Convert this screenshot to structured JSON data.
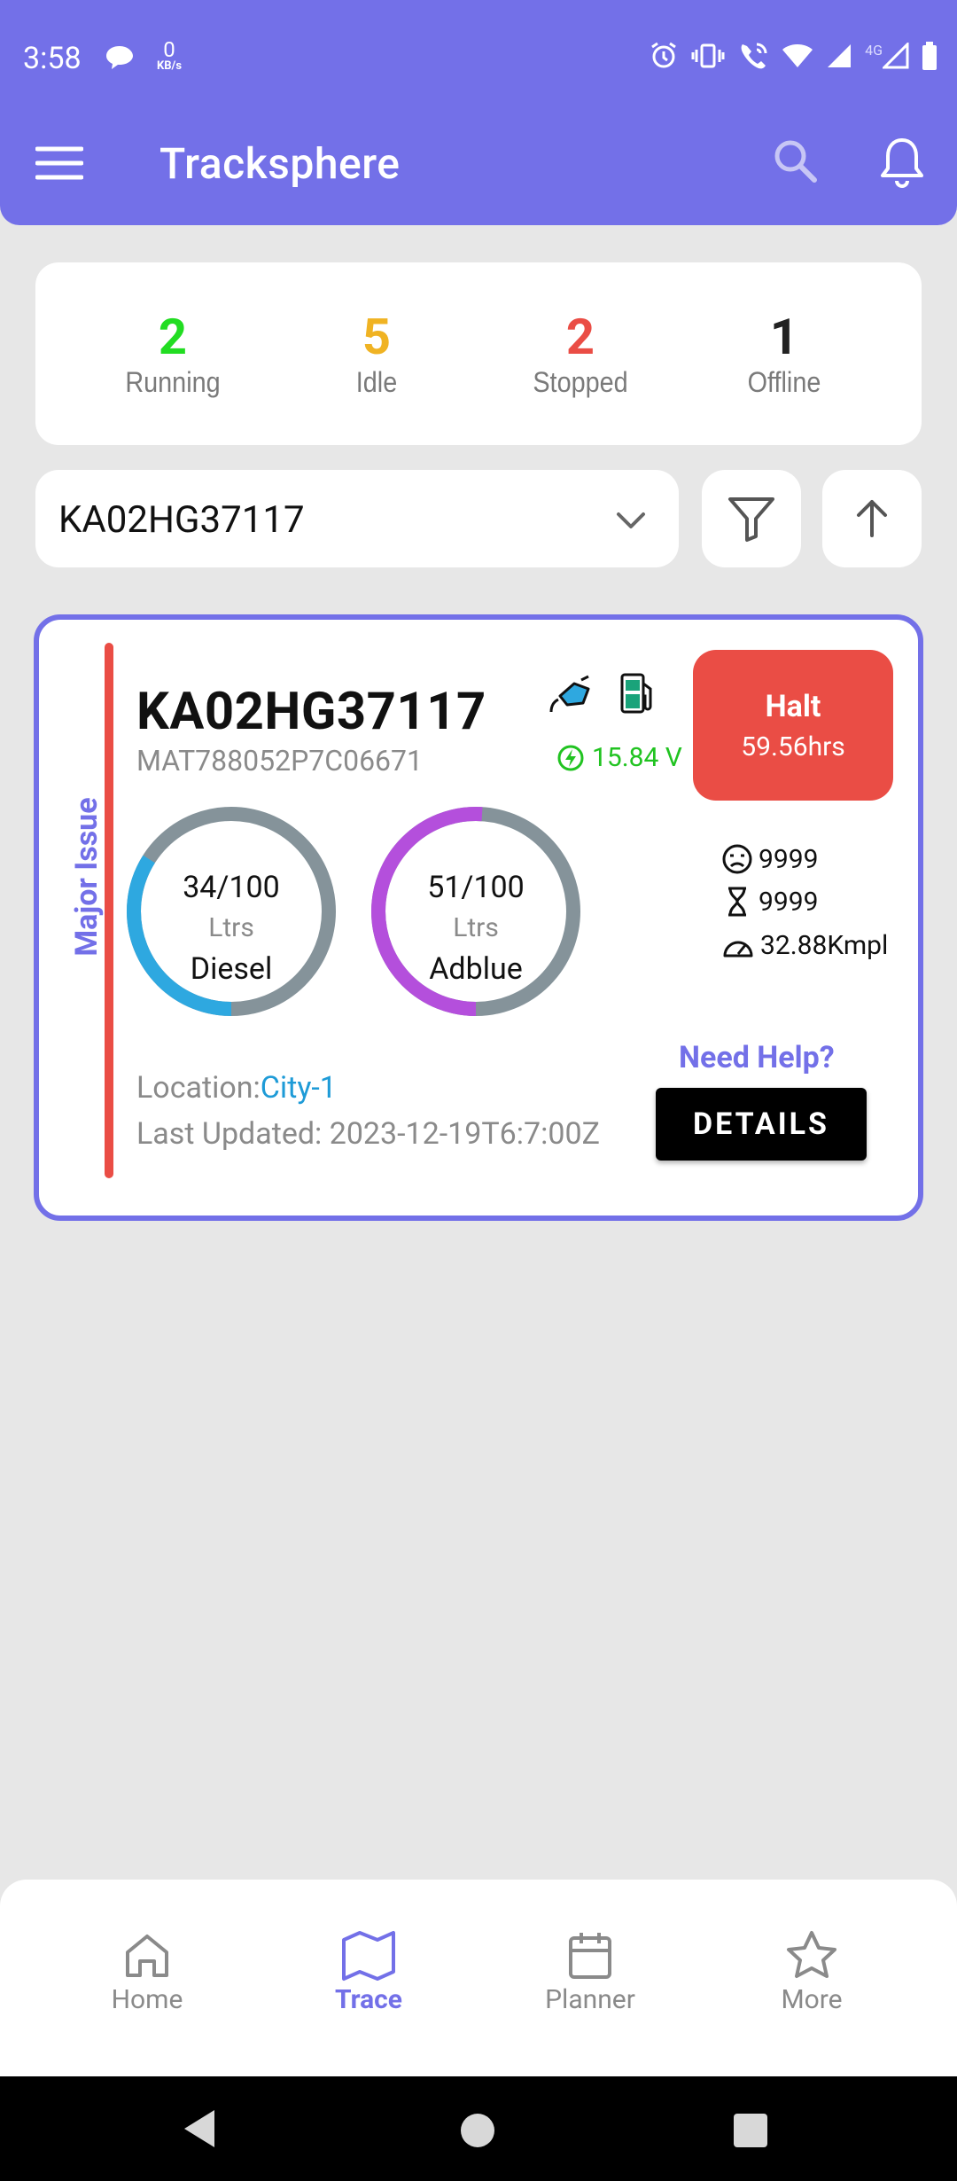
{
  "status_bar": {
    "time": "3:58",
    "net_speed": "0",
    "net_unit": "KB/s",
    "network_type": "4G"
  },
  "app": {
    "title": "Trackspher​e"
  },
  "stats": [
    {
      "count": "2",
      "label": "Running",
      "color": "#22dd22"
    },
    {
      "count": "5",
      "label": "Idle",
      "color": "#f0b323"
    },
    {
      "count": "2",
      "label": "Stopped",
      "color": "#ea4d45"
    },
    {
      "count": "1",
      "label": "Offline",
      "color": "#222222"
    }
  ],
  "search": {
    "selected_vehicle": "KA02HG37117"
  },
  "vehicle": {
    "issue": "Major Issue",
    "number": "KA02HG37117",
    "vin": "MAT788052P7C06671",
    "voltage": "15.84 V",
    "halt_label": "Halt",
    "halt_time": "59.56hrs",
    "diesel": {
      "value": "34/100",
      "unit": "Ltrs",
      "name": "Diesel",
      "fraction": 0.34,
      "color": "#2ea8e0"
    },
    "adblue": {
      "value": "51/100",
      "unit": "Ltrs",
      "name": "Adblue",
      "fraction": 0.51,
      "color": "#b44fdc"
    },
    "odometer": "9999",
    "engine_hours": "9999",
    "mileage": "32.88Kmpl",
    "need_help": "Need Help?",
    "location_label": "Location:",
    "location_city": "City-1",
    "last_updated": "Last Updated: 2023-12-19T6:7:00Z",
    "details_label": "DETAILS"
  },
  "nav": [
    {
      "label": "Home",
      "icon": "home-icon"
    },
    {
      "label": "Trace",
      "icon": "map-icon",
      "active": true
    },
    {
      "label": "Planner",
      "icon": "calendar-icon"
    },
    {
      "label": "More",
      "icon": "star-icon"
    }
  ],
  "colors": {
    "accent": "#7370e8",
    "danger": "#ea4d45",
    "ring_track": "#85939a"
  }
}
